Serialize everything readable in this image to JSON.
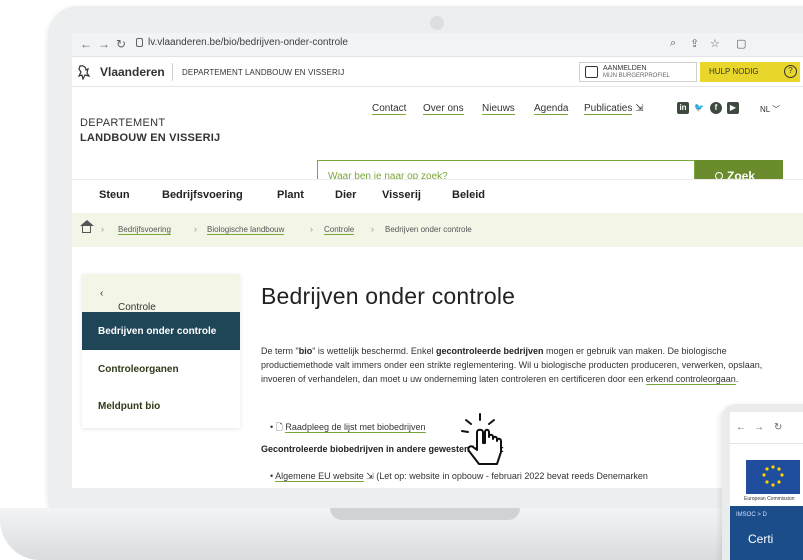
{
  "browser": {
    "url": "lv.vlaanderen.be/bio/bedrijven-onder-controle"
  },
  "vlaanderen_bar": {
    "brand": "Vlaanderen",
    "department": "DEPARTEMENT LANDBOUW EN VISSERIJ",
    "login_line1": "AANMELDEN",
    "login_line2": "MIJN BURGERPROFIEL",
    "help_label": "HULP NODIG",
    "help_icon": "?"
  },
  "header": {
    "logo_line1": "DEPARTEMENT",
    "logo_line2": "LANDBOUW EN VISSERIJ",
    "top_links": [
      "Contact",
      "Over ons",
      "Nieuws",
      "Agenda",
      "Publicaties"
    ],
    "social": [
      "in",
      "t",
      "f",
      "yt"
    ],
    "language": "NL",
    "search_placeholder": "Waar ben je naar op zoek?",
    "search_button": "Zoek"
  },
  "main_nav": [
    "Steun",
    "Bedrijfsvoering",
    "Plant",
    "Dier",
    "Visserij",
    "Beleid"
  ],
  "breadcrumb": [
    "Bedrijfsvoering",
    "Biologische landbouw",
    "Controle",
    "Bedrijven onder controle"
  ],
  "sidebar": {
    "back_label": "Controle",
    "active": "Bedrijven onder controle",
    "items": [
      "Controleorganen",
      "Meldpunt bio"
    ]
  },
  "content": {
    "title": "Bedrijven onder controle",
    "para_intro": "De term \"",
    "para_bio": "bio",
    "para_mid1": "\" is wettelijk beschermd. Enkel ",
    "para_bold": "gecontroleerde bedrijven",
    "para_mid2": " mogen er gebruik van maken. De biologische productiemethode valt immers onder een strikte reglementering. Wil u biologische producten produceren, verwerken, opslaan, invoeren of verhandelen, dan moet u uw onderneming laten controleren en certificeren door een ",
    "para_link": "erkend controleorgaan",
    "para_end": ".",
    "bullet1": "Raadpleeg de lijst met biobedrijven",
    "subheading": "Gecontroleerde biobedrijven in andere gewesten/landen:",
    "bullet2_link": "Algemene EU website",
    "bullet2_rest": "(Let op: website in opbouw - februari 2022 bevat reeds Denemarken"
  },
  "phone": {
    "eu_label": "European Commission",
    "crumb": "IMSOC > D",
    "heading": "Certi"
  },
  "colors": {
    "accent_green": "#6b8c2d",
    "active_nav": "#1f4657",
    "help_yellow": "#e9d62a",
    "breadcrumb_bg": "#f3f6e6"
  }
}
